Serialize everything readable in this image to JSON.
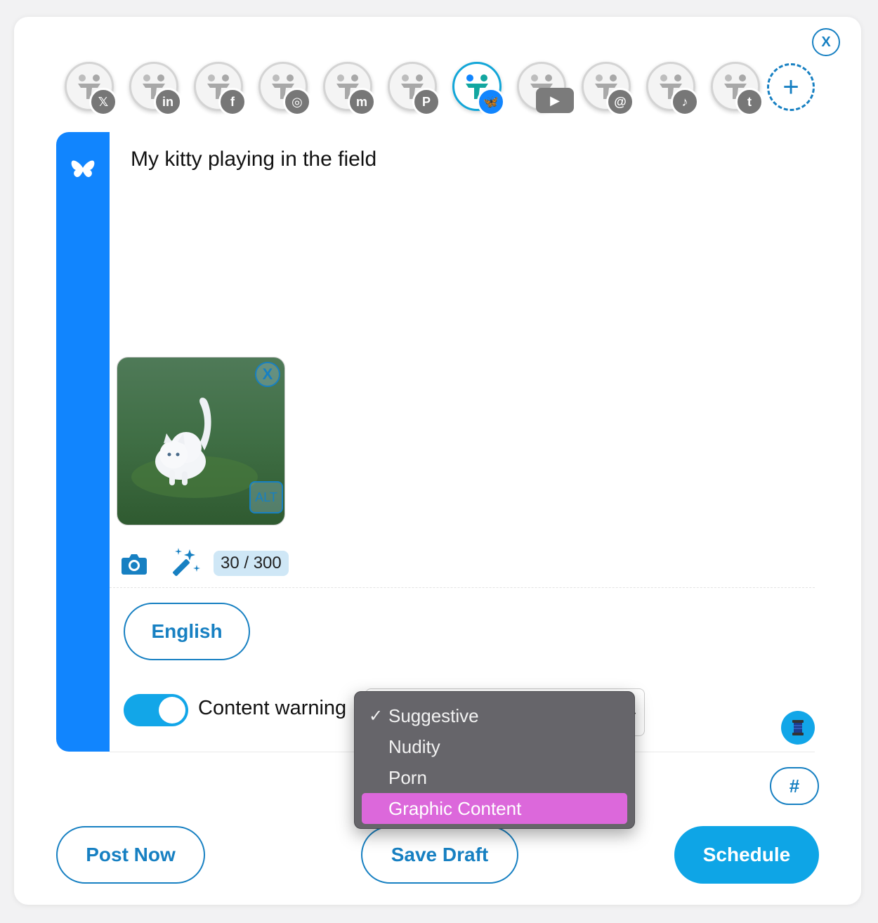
{
  "modal": {
    "close_label": "X"
  },
  "accounts": [
    {
      "network": "X",
      "badge": "𝕏",
      "active": false
    },
    {
      "network": "LinkedIn",
      "badge": "in",
      "active": false
    },
    {
      "network": "Facebook",
      "badge": "f",
      "active": false
    },
    {
      "network": "Instagram",
      "badge": "◎",
      "active": false
    },
    {
      "network": "Mastodon",
      "badge": "m",
      "active": false
    },
    {
      "network": "Pinterest",
      "badge": "P",
      "active": false
    },
    {
      "network": "Bluesky",
      "badge": "🦋",
      "active": true
    },
    {
      "network": "YouTube",
      "badge": "▶",
      "active": false
    },
    {
      "network": "Threads",
      "badge": "@",
      "active": false
    },
    {
      "network": "TikTok",
      "badge": "♪",
      "active": false
    },
    {
      "network": "Tumblr",
      "badge": "t",
      "active": false
    }
  ],
  "add_account_label": "+",
  "editor": {
    "network_icon": "butterfly-icon",
    "post_text": "My kitty playing in the field",
    "media": {
      "remove_label": "X",
      "alt_label": "ALT"
    },
    "char_count": "30 / 300",
    "language_button": "English",
    "content_warning": {
      "label": "Content warning",
      "enabled": true,
      "options": [
        "Suggestive",
        "Nudity",
        "Porn",
        "Graphic Content"
      ],
      "selected": "Suggestive",
      "highlighted": "Graphic Content",
      "check_mark": "✓"
    },
    "hashtag_button": "#"
  },
  "footer": {
    "post_now": "Post Now",
    "save_draft": "Save Draft",
    "schedule": "Schedule"
  },
  "colors": {
    "accent": "#1780c2",
    "bluesky": "#1185fe",
    "schedule": "#0ea5e6",
    "menu_highlight": "#dc68db"
  }
}
